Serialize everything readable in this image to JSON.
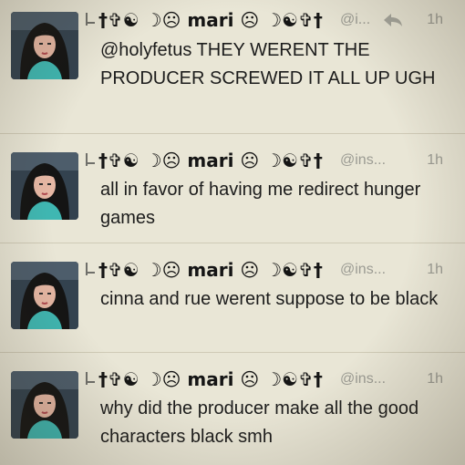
{
  "tweets": [
    {
      "name": "†✞☯ ☽☹ mari ☹ ☽☯✞†",
      "handle": "@i...",
      "time": "1h",
      "text": "@holyfetus THEY WERENT THE PRODUCER SCREWED IT ALL UP UGH",
      "has_reply_icon": true
    },
    {
      "name": "†✞☯ ☽☹ mari ☹ ☽☯✞†",
      "handle": "@ins...",
      "time": "1h",
      "text": "all in favor of having me redirect hunger games",
      "has_reply_icon": false
    },
    {
      "name": "†✞☯ ☽☹ mari ☹ ☽☯✞†",
      "handle": "@ins...",
      "time": "1h",
      "text": "cinna and rue werent suppose to be black",
      "has_reply_icon": false
    },
    {
      "name": "†✞☯ ☽☹ mari ☹ ☽☯✞†",
      "handle": "@ins...",
      "time": "1h",
      "text": "why did the producer make all the good characters black smh",
      "has_reply_icon": false
    }
  ],
  "icons": {
    "conversation": "conversation-icon",
    "reply": "reply-icon",
    "avatar": "avatar"
  },
  "colors": {
    "background": "#e9e6d6",
    "text": "#1c1c1c",
    "muted": "#9b9b93"
  }
}
